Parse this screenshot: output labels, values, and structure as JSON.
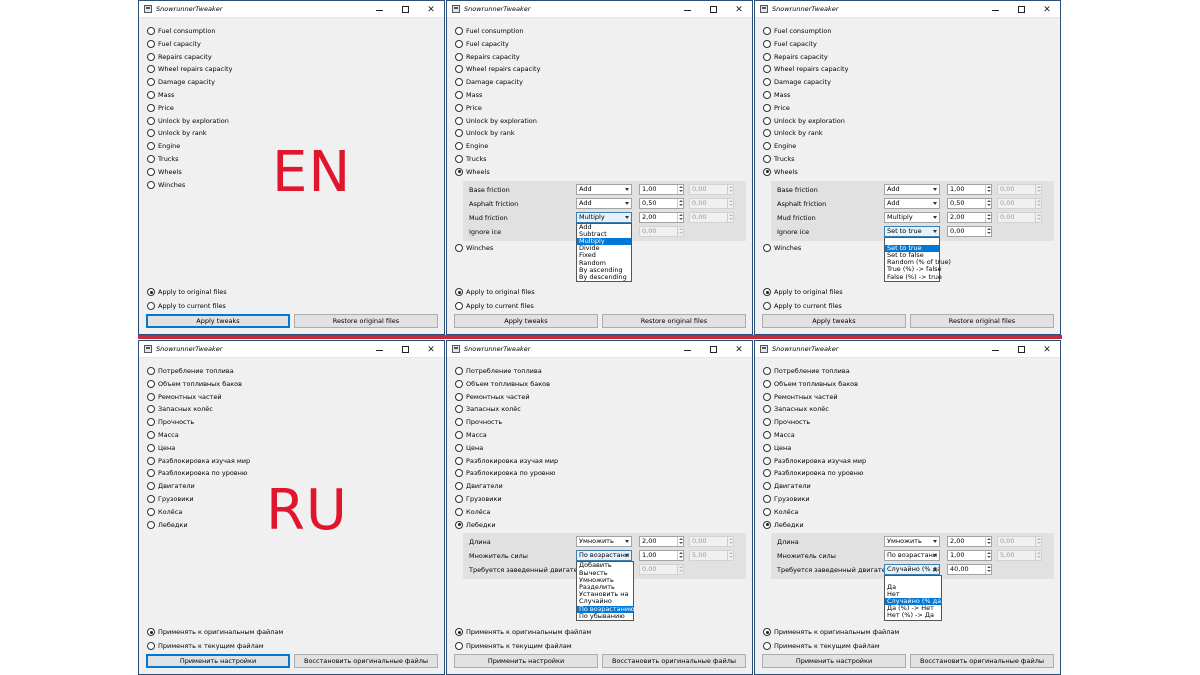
{
  "app_title": "SnowrunnerTweaker",
  "en_label": "EN",
  "ru_label": "RU",
  "en": {
    "categories": [
      "Fuel consumption",
      "Fuel capacity",
      "Repairs capacity",
      "Wheel repairs capacity",
      "Damage capacity",
      "Mass",
      "Price",
      "Unlock by exploration",
      "Unlock by rank",
      "Engine",
      "Trucks",
      "Wheels",
      "Winches"
    ],
    "apply_original": "Apply to original files",
    "apply_current": "Apply to current files",
    "apply_button": "Apply tweaks",
    "restore_button": "Restore original files",
    "window2": {
      "params": [
        {
          "label": "Base friction",
          "mode": "Add",
          "v1": "1,00",
          "v2": "0,00"
        },
        {
          "label": "Asphalt friction",
          "mode": "Add",
          "v1": "0,50",
          "v2": "0,00"
        },
        {
          "label": "Mud friction",
          "mode": "Multiply",
          "v1": "2,00",
          "v2": "0,00"
        },
        {
          "label": "Ignore ice",
          "mode": "",
          "v1": "0,00",
          "v2": ""
        }
      ],
      "dropdown": [
        "Add",
        "Subtract",
        "Multiply",
        "Divide",
        "Fixed",
        "Random",
        "By ascending",
        "By descending"
      ],
      "dropdown_selected": "Multiply"
    },
    "window3": {
      "params": [
        {
          "label": "Base friction",
          "mode": "Add",
          "v1": "1,00",
          "v2": "0,00"
        },
        {
          "label": "Asphalt friction",
          "mode": "Add",
          "v1": "0,50",
          "v2": "0,00"
        },
        {
          "label": "Mud friction",
          "mode": "Multiply",
          "v1": "2,00",
          "v2": "0,00"
        },
        {
          "label": "Ignore ice",
          "mode": "Set to true",
          "v1": "0,00",
          "v2": ""
        }
      ],
      "dropdown": [
        "",
        "Set to true",
        "Set to false",
        "Random (% of true)",
        "True (%) -> false",
        "False (%) -> true"
      ],
      "dropdown_selected": "Set to true"
    }
  },
  "ru": {
    "categories": [
      "Потребление топлива",
      "Объем топливных баков",
      "Ремонтных частей",
      "Запасных колёс",
      "Прочность",
      "Масса",
      "Цена",
      "Разблокировка изучая мир",
      "Разблокировка по уровню",
      "Двигатели",
      "Грузовики",
      "Колёса",
      "Лебедки"
    ],
    "apply_original": "Применять к оригинальным файлам",
    "apply_current": "Применять к текущим файлам",
    "apply_button": "Применить настройки",
    "restore_button": "Восстановить оригинальные файлы",
    "window2": {
      "params": [
        {
          "label": "Длина",
          "mode": "Умножить",
          "v1": "2,00",
          "v2": "0,00"
        },
        {
          "label": "Множитель силы",
          "mode": "По возрастани",
          "v1": "1,00",
          "v2": "5,00"
        },
        {
          "label": "Требуется заведенный двигатель",
          "mode": "",
          "v1": "0,00",
          "v2": ""
        }
      ],
      "dropdown": [
        "Добавить",
        "Вычесть",
        "Умножить",
        "Разделить",
        "Установить на",
        "Случайно",
        "По возрастанию",
        "По убыванию"
      ],
      "dropdown_selected": "По возрастанию"
    },
    "window3": {
      "params": [
        {
          "label": "Длина",
          "mode": "Умножить",
          "v1": "2,00",
          "v2": "0,00"
        },
        {
          "label": "Множитель силы",
          "mode": "По возрастани",
          "v1": "1,00",
          "v2": "5,00"
        },
        {
          "label": "Требуется заведенный двигатель",
          "mode": "Случайно (% да)",
          "v1": "40,00",
          "v2": ""
        }
      ],
      "dropdown": [
        "",
        "Да",
        "Нет",
        "Случайно (% да)",
        "Да (%) -> Нет",
        "Нет (%) -> Да"
      ],
      "dropdown_selected": "Случайно (% да)"
    }
  }
}
